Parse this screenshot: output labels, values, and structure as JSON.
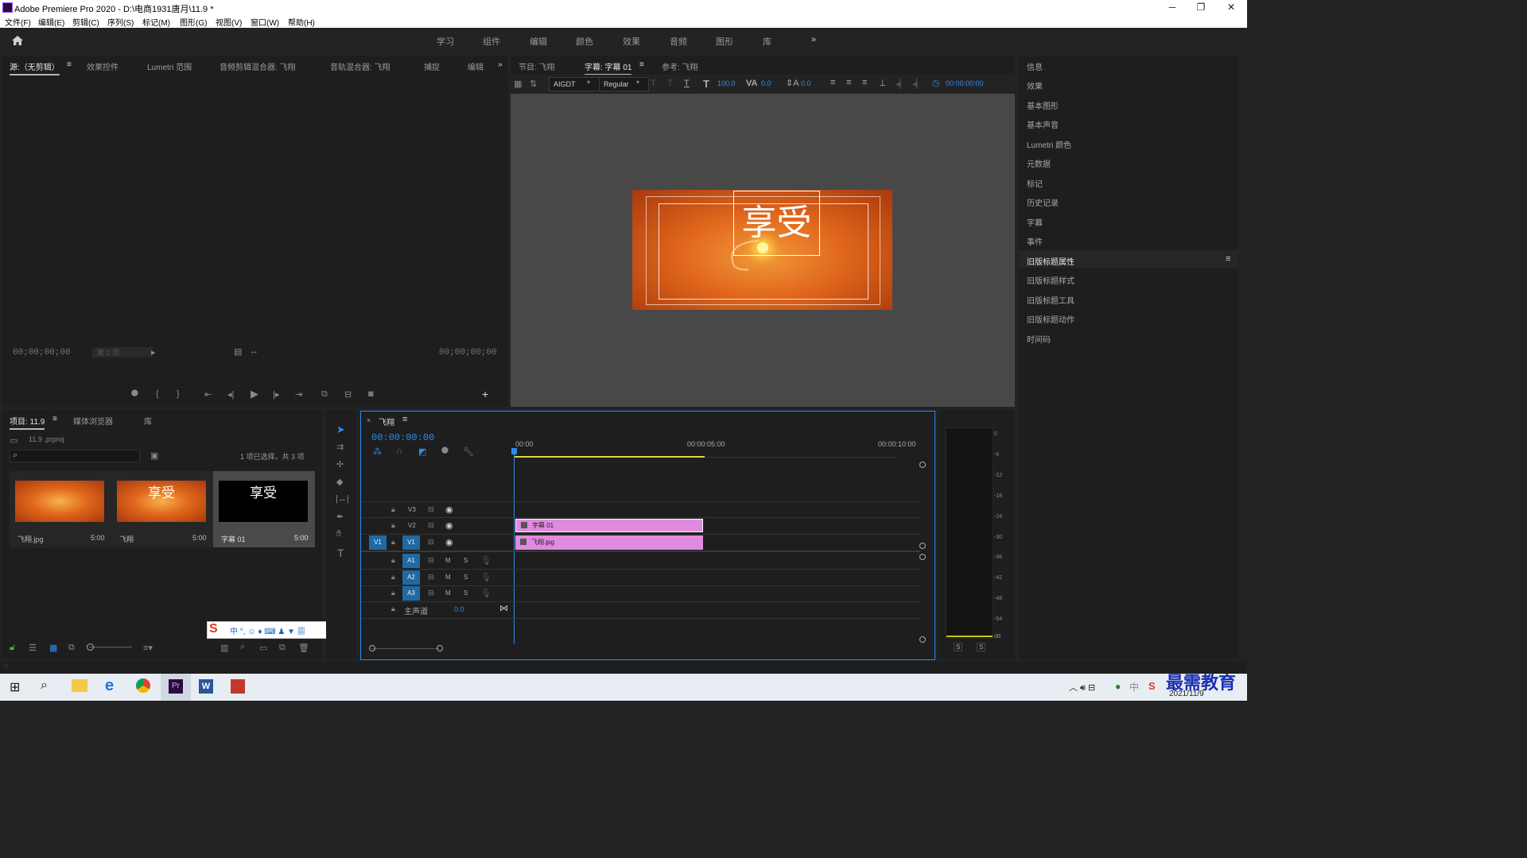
{
  "window": {
    "title": "Adobe Premiere Pro 2020 - D:\\电商1931唐月\\11.9  *",
    "controls": [
      "─",
      "❐",
      "✕"
    ]
  },
  "menu": [
    "文件(F)",
    "编辑(E)",
    "剪辑(C)",
    "序列(S)",
    "标记(M)",
    "图形(G)",
    "视图(V)",
    "窗口(W)",
    "帮助(H)"
  ],
  "workspaces": [
    "学习",
    "组件",
    "编辑",
    "颜色",
    "效果",
    "音频",
    "图形",
    "库"
  ],
  "source_panel": {
    "tabs": [
      "源:（无剪辑）",
      "效果控件",
      "Lumetri 范围",
      "音频剪辑混合器: 飞翔",
      "音轨混合器: 飞翔",
      "捕捉",
      "编辑"
    ],
    "tc_left": "00;00;00;00",
    "tc_right": "00;00;00;00",
    "page": "第 1 页"
  },
  "program_panel": {
    "tabs": [
      "节目: 飞翔",
      "字幕: 字幕 01",
      "参考: 飞翔"
    ],
    "font": "AIGDT",
    "style": "Regular",
    "size": "100.0",
    "kerning": "0.0",
    "leading": "0.0",
    "tc": "00:00:00:00",
    "title_text": "享受"
  },
  "right_panel": {
    "items": [
      "信息",
      "效果",
      "基本图形",
      "基本声音",
      "Lumetri 颜色",
      "元数据",
      "标记",
      "历史记录",
      "字幕",
      "事件",
      "旧版标题属性",
      "旧版标题样式",
      "旧版标题工具",
      "旧版标题动作",
      "时间码"
    ],
    "active": "旧版标题属性"
  },
  "project_panel": {
    "tabs": [
      "项目: 11.9",
      "媒体浏览器",
      "库"
    ],
    "file": "11.9 .prproj",
    "status": "1 项已选择，共 3 项",
    "items": [
      {
        "name": "飞翔.jpg",
        "dur": "5:00"
      },
      {
        "name": "飞翔",
        "dur": "5:00"
      },
      {
        "name": "字幕 01",
        "dur": "5:00"
      }
    ],
    "thumb_text": "享受"
  },
  "timeline": {
    "tab": "飞翔",
    "tc": "00:00:00:00",
    "ruler": [
      "00:00",
      "00:00:05:00",
      "00:00:10:00"
    ],
    "video_tracks": [
      "V3",
      "V2",
      "V1"
    ],
    "audio_tracks": [
      "A1",
      "A2",
      "A3"
    ],
    "master": "主声道",
    "master_val": "0.0",
    "src_patch": "V1",
    "clips": [
      {
        "name": "字幕 01"
      },
      {
        "name": "飞翔.jpg"
      }
    ]
  },
  "meter": {
    "scale": [
      "0",
      "-6",
      "-12",
      "-18",
      "-24",
      "-30",
      "-36",
      "-42",
      "-48",
      "-54",
      "dB"
    ],
    "solo": [
      "S",
      "S"
    ]
  },
  "taskbar": {
    "date": "2021/11/9",
    "watermark": "最需教育"
  },
  "colors": {
    "accent": "#2d8ceb",
    "clip": "#e08ae0",
    "orange": "#e0661c"
  }
}
